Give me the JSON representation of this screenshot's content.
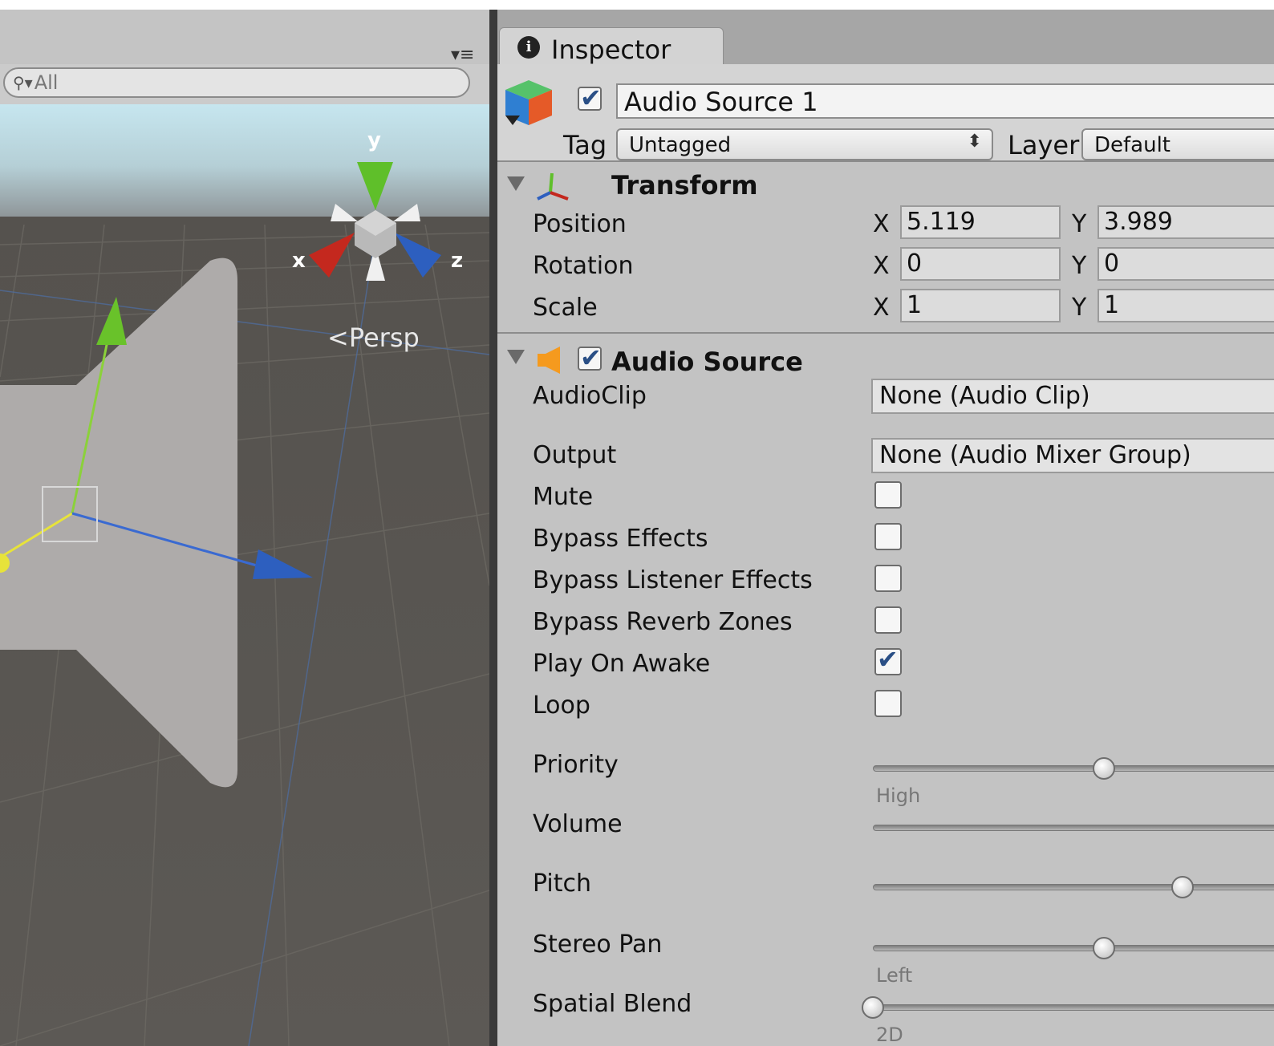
{
  "scene": {
    "search_filter": "All",
    "persp_label": "Persp",
    "gizmo_axes": {
      "x": "x",
      "y": "y",
      "z": "z"
    }
  },
  "inspector": {
    "tab_label": "Inspector",
    "gameobject": {
      "active": true,
      "name": "Audio Source 1",
      "tag_label": "Tag",
      "tag_value": "Untagged",
      "layer_label": "Layer",
      "layer_value": "Default"
    },
    "transform": {
      "title": "Transform",
      "rows": [
        {
          "label": "Position",
          "x": "5.119",
          "y": "3.989"
        },
        {
          "label": "Rotation",
          "x": "0",
          "y": "0"
        },
        {
          "label": "Scale",
          "x": "1",
          "y": "1"
        }
      ],
      "axis_x": "X",
      "axis_y": "Y"
    },
    "audio_source": {
      "title": "Audio Source",
      "enabled": true,
      "audio_clip_label": "AudioClip",
      "audio_clip_value": "None (Audio Clip)",
      "output_label": "Output",
      "output_value": "None (Audio Mixer Group)",
      "toggles": [
        {
          "label": "Mute",
          "checked": false
        },
        {
          "label": "Bypass Effects",
          "checked": false
        },
        {
          "label": "Bypass Listener Effects",
          "checked": false
        },
        {
          "label": "Bypass Reverb Zones",
          "checked": false
        },
        {
          "label": "Play On Awake",
          "checked": true
        },
        {
          "label": "Loop",
          "checked": false
        }
      ],
      "sliders": [
        {
          "label": "Priority",
          "value": 0.5,
          "note": "High"
        },
        {
          "label": "Volume",
          "value": 1.0,
          "note": ""
        },
        {
          "label": "Pitch",
          "value": 0.67,
          "note": ""
        },
        {
          "label": "Stereo Pan",
          "value": 0.5,
          "note": "Left"
        },
        {
          "label": "Spatial Blend",
          "value": 0.0,
          "note": "2D"
        }
      ]
    }
  },
  "colors": {
    "gizmo_x": "#c4281e",
    "gizmo_y": "#5fbf2a",
    "gizmo_z": "#2d5fbf",
    "check": "#2a4f86"
  }
}
